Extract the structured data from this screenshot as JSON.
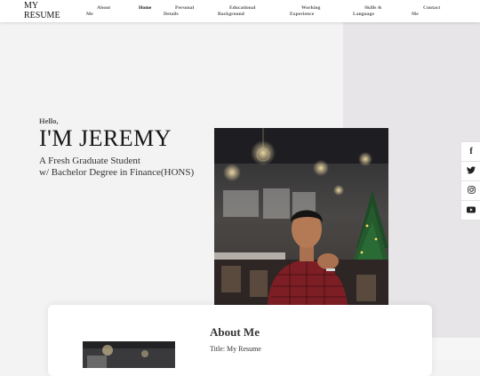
{
  "nav": {
    "brand_line1": "MY",
    "brand_line2": "RESUME",
    "links": [
      {
        "line1": "About",
        "line2": "Me"
      },
      {
        "line1": "Home",
        "line2": ""
      },
      {
        "line1": "Personal",
        "line2": "Details"
      },
      {
        "line1": "Educational",
        "line2": "Background"
      },
      {
        "line1": "Working",
        "line2": "Experience"
      },
      {
        "line1": "Skills &",
        "line2": "Language"
      },
      {
        "line1": "Contact",
        "line2": "Me"
      }
    ]
  },
  "hero": {
    "hello": "Hello,",
    "name": "I'M JEREMY",
    "tagline_line1": "A Fresh Graduate Student",
    "tagline_line2": "w/ Bachelor Degree in Finance(HONS)"
  },
  "social": [
    {
      "icon": "facebook-icon",
      "glyph": "f"
    },
    {
      "icon": "twitter-icon",
      "glyph": "🐦"
    },
    {
      "icon": "instagram-icon",
      "glyph": "◎"
    },
    {
      "icon": "youtube-icon",
      "glyph": "▶"
    }
  ],
  "about": {
    "title": "About Me",
    "title_line": "Title: My Resume"
  },
  "colors": {
    "page_bg": "#f3f3f4",
    "right_panel": "#e7e5e8",
    "card_bg": "#ffffff"
  }
}
